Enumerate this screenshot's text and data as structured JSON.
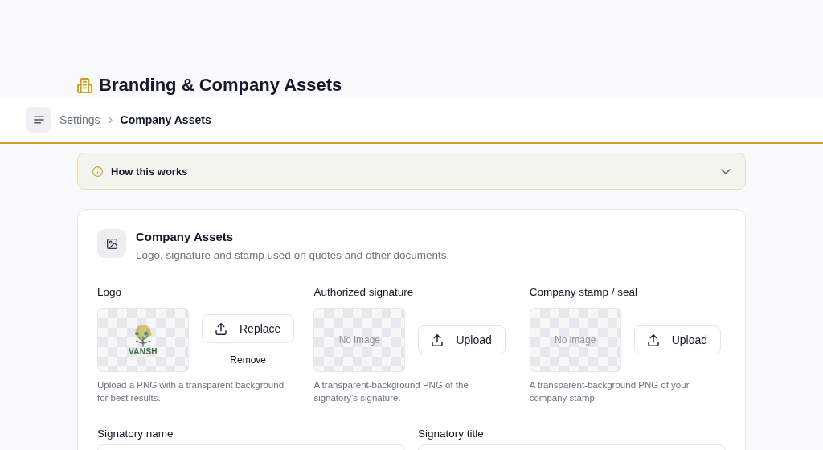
{
  "page": {
    "title": "Branding & Company Assets"
  },
  "header": {
    "breadcrumbs": [
      {
        "label": "Settings",
        "current": false
      },
      {
        "label": "Company Assets",
        "current": true
      }
    ]
  },
  "info_panel": {
    "title": "How this works",
    "expanded": false
  },
  "card": {
    "title": "Company Assets",
    "subtitle": "Logo, signature and stamp used on quotes and other documents.",
    "assets": [
      {
        "kind": "image",
        "label": "Logo",
        "logo_text": "VANSH",
        "button": "Replace",
        "secondary_action": "Remove",
        "hint": "Upload a PNG with a transparent background for best results."
      },
      {
        "kind": "empty",
        "label": "Authorized signature",
        "placeholder": "No image",
        "button": "Upload",
        "hint": "A transparent-background PNG of the signatory's signature."
      },
      {
        "kind": "empty",
        "label": "Company stamp / seal",
        "placeholder": "No image",
        "button": "Upload",
        "hint": "A transparent-background PNG of your company stamp."
      }
    ],
    "fields": [
      {
        "label": "Signatory name"
      },
      {
        "label": "Signatory title"
      }
    ]
  }
}
